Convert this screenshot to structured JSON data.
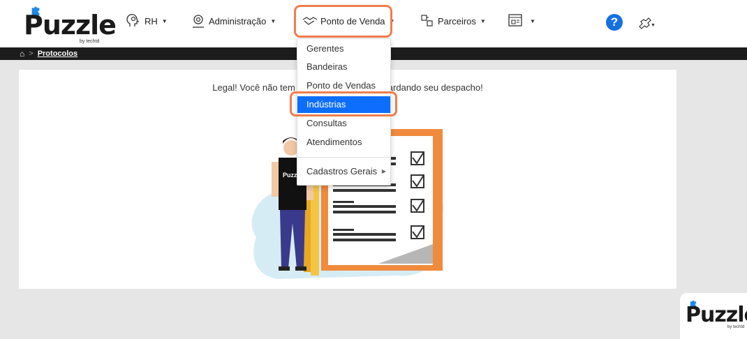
{
  "brand": {
    "name": "Puzzle",
    "tagline": "by techtd"
  },
  "nav": {
    "rh": "RH",
    "administracao": "Administração",
    "ponto_de_venda": "Ponto de Venda",
    "parceiros": "Parceiros"
  },
  "breadcrumb": {
    "current": "Protocolos"
  },
  "main": {
    "message": "Legal! Você não tem nenhum protocolo aguardando seu despacho!"
  },
  "illustration": {
    "shirt_text": "Puzzle"
  },
  "dropdown": {
    "items": [
      {
        "label": "Gerentes"
      },
      {
        "label": "Bandeiras"
      },
      {
        "label": "Ponto de Vendas"
      },
      {
        "label": "Indústrias"
      },
      {
        "label": "Consultas"
      },
      {
        "label": "Atendimentos"
      },
      {
        "label": "Cadastros Gerais"
      }
    ],
    "active_index": 3
  },
  "colors": {
    "accent": "#0d6efd",
    "highlight": "#f07c4e",
    "help": "#1570e0",
    "logo_blue": "#1e88e5"
  }
}
